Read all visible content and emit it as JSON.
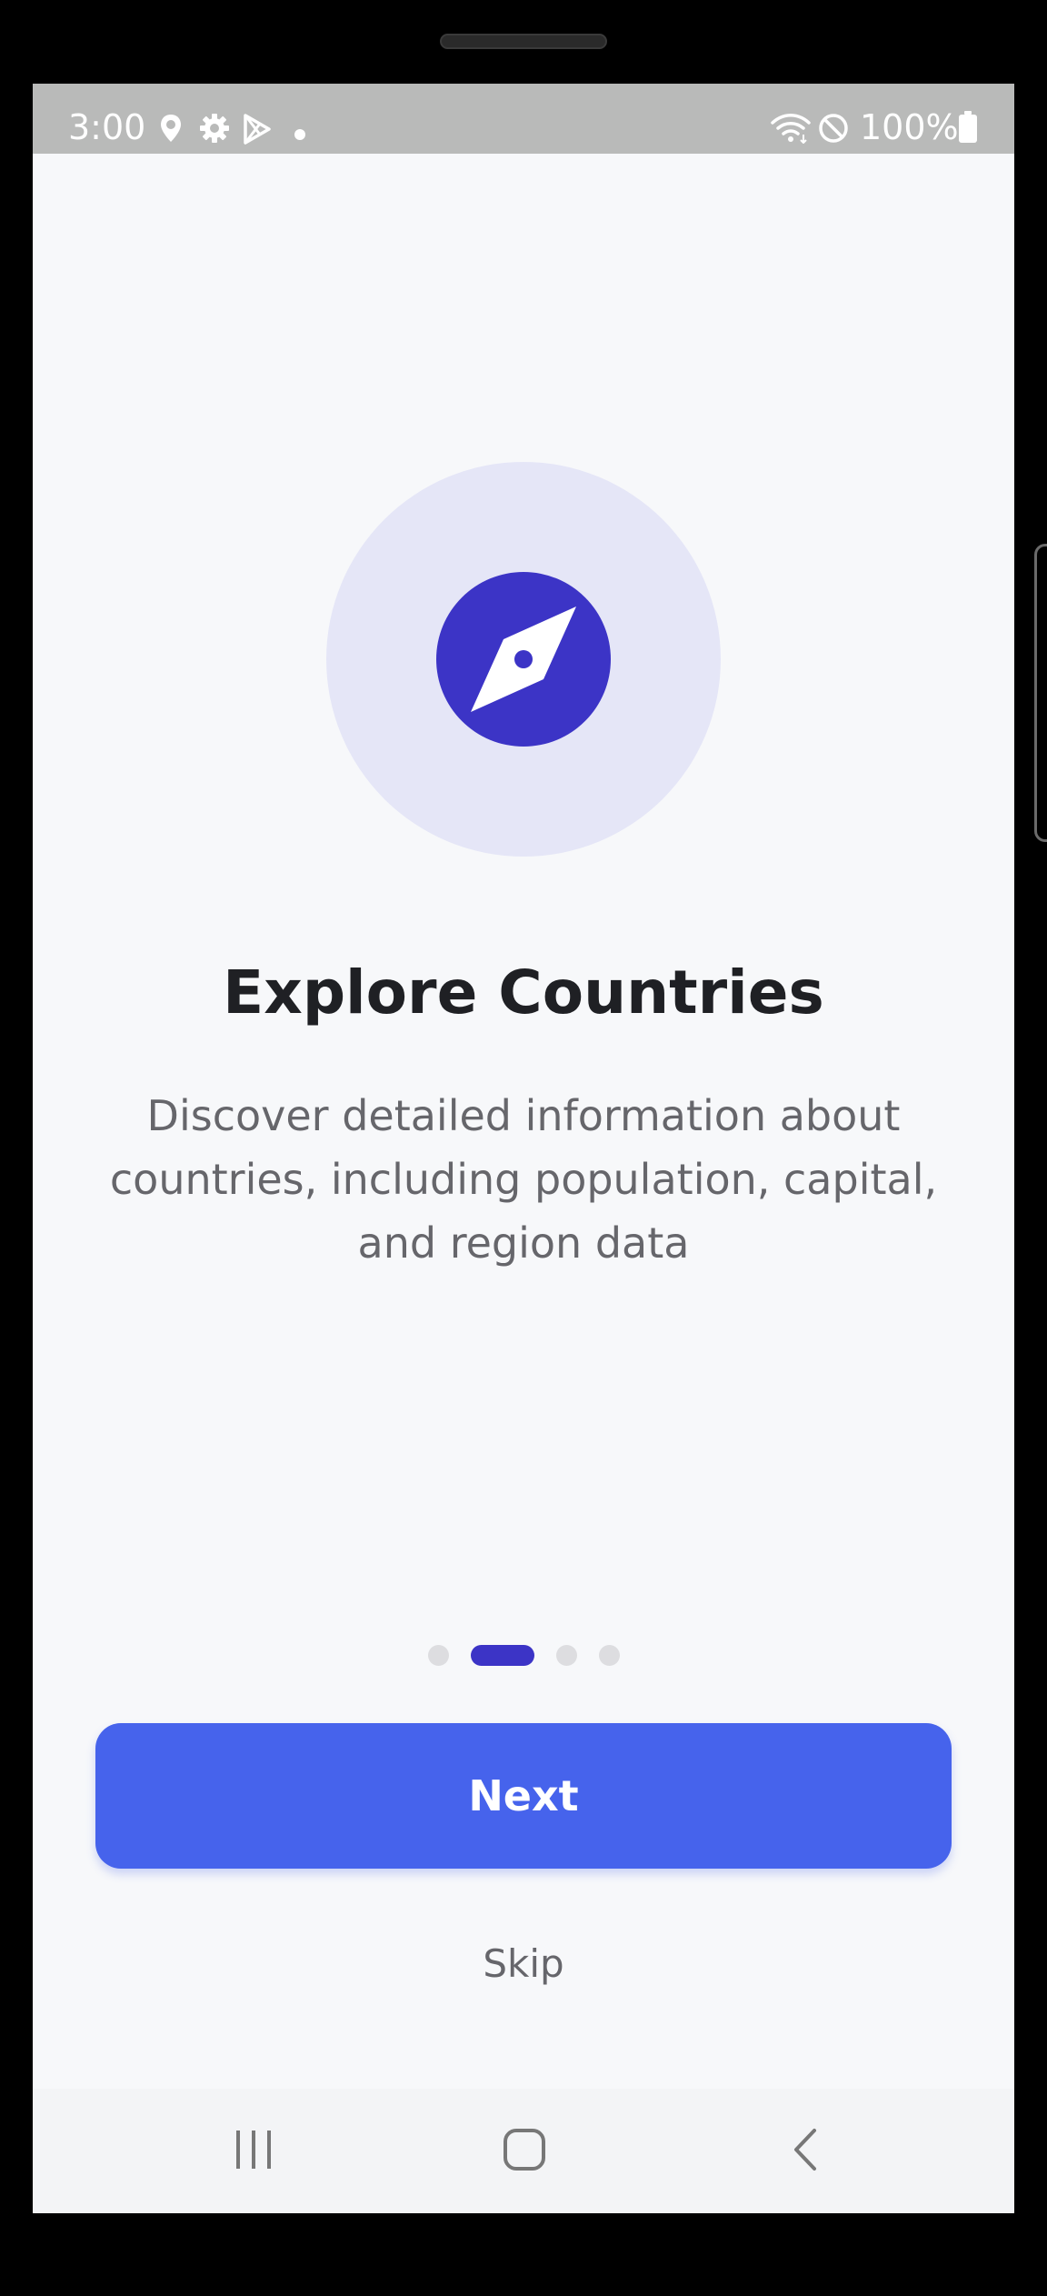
{
  "status_bar": {
    "time": "3:00",
    "battery": "100%",
    "icons": [
      "location-pin-icon",
      "gear-icon",
      "play-store-icon",
      "notification-dot-icon",
      "wifi-icon",
      "do-not-disturb-icon",
      "battery-icon"
    ]
  },
  "onboarding": {
    "icon": "compass-icon",
    "title": "Explore Countries",
    "description": "Discover detailed information about countries, including population, capital, and region data",
    "page_indicator": {
      "total": 4,
      "active_index": 1
    },
    "next_label": "Next",
    "skip_label": "Skip"
  },
  "nav_bar": {
    "icons": [
      "recent-apps-icon",
      "home-icon",
      "back-icon"
    ]
  },
  "colors": {
    "accent": "#3c34c6",
    "button": "#4663ec",
    "hero_bg": "#e5e6f7",
    "screen_bg": "#f7f8fa"
  }
}
